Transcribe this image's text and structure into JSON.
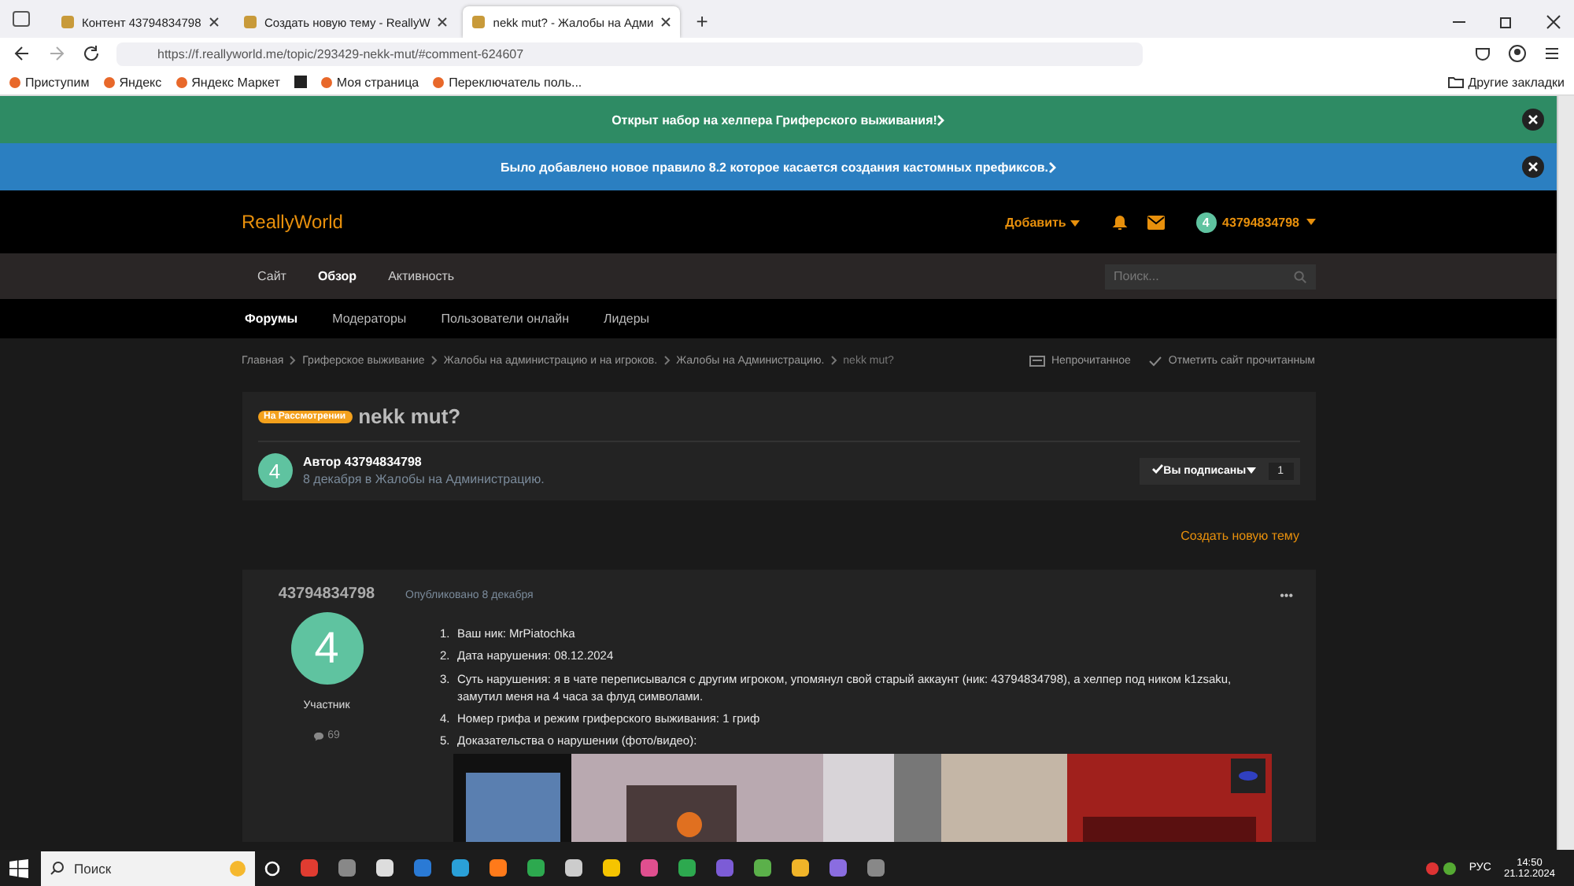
{
  "browser": {
    "tabs": [
      {
        "label": "Контент 43794834798",
        "selected": false
      },
      {
        "label": "Создать новую тему - ReallyW",
        "selected": false
      },
      {
        "label": "nekk mut? - Жалобы на Адми",
        "selected": true
      }
    ],
    "new_tab": "+",
    "url": "https://f.reallyworld.me/topic/293429-nekk-mut/#comment-624607",
    "bookmarks": [
      {
        "kind": "link",
        "label": "Приступим"
      },
      {
        "kind": "link",
        "label": "Яндекс"
      },
      {
        "kind": "link",
        "label": "Яндекс Маркет"
      },
      {
        "kind": "icon"
      },
      {
        "kind": "link",
        "label": "Моя страница"
      },
      {
        "kind": "link",
        "label": "Переключатель поль..."
      }
    ],
    "other_bookmarks": "Другие закладки"
  },
  "banners": [
    {
      "text": "Открыт набор на хелпера Гриферского выживания!",
      "color": "#2e8b64"
    },
    {
      "text": "Было добавлено новое правило 8.2 которое касается создания кастомных префиксов.",
      "color": "#2b7fc1"
    }
  ],
  "header": {
    "logo": "ReallyWorld",
    "add": "Добавить",
    "avatar": "4",
    "user": "43794834798"
  },
  "nav": [
    {
      "label": "Сайт",
      "selected": false
    },
    {
      "label": "Обзор",
      "selected": true
    },
    {
      "label": "Активность",
      "selected": false
    }
  ],
  "search": {
    "placeholder": "Поиск..."
  },
  "subnav": [
    {
      "label": "Форумы",
      "selected": true
    },
    {
      "label": "Модераторы",
      "selected": false
    },
    {
      "label": "Пользователи онлайн",
      "selected": false
    },
    {
      "label": "Лидеры",
      "selected": false
    }
  ],
  "breadcrumbs": [
    "Главная",
    "Гриферское выживание",
    "Жалобы на администрацию и на игроков.",
    "Жалобы на Администрацию.",
    "nekk mut?"
  ],
  "breadcrumb_actions": [
    "Непрочитанное",
    "Отметить сайт прочитанным"
  ],
  "topic": {
    "badge": "На Рассмотрении",
    "title": "nekk mut?",
    "avatar": "4",
    "author": "Автор 43794834798",
    "meta": "8 декабря в Жалобы на Администрацию.",
    "follow": "Вы подписаны",
    "follow_count": "1"
  },
  "create_topic": "Создать новую тему",
  "post": {
    "author": "43794834798",
    "avatar": "4",
    "role": "Участник",
    "posts": "69",
    "published": "Опубликовано 8 декабря",
    "menu": "•••",
    "items": [
      {
        "num": "1.",
        "text": "Ваш ник: MrPiatochka"
      },
      {
        "num": "2.",
        "text": "Дата нарушения: 08.12.2024"
      },
      {
        "num": "3.",
        "text": "Суть нарушения: я в чате переписывался с другим  игроком, упомянул свой старый аккаунт (ник: 43794834798), а хелпер под ником k1zsaku, замутил меня на 4 часа за флуд символами."
      },
      {
        "num": "4.",
        "text": "Номер грифа и режим гриферского выживания: 1 гриф"
      },
      {
        "num": "5.",
        "text": "Доказательства о нарушении (фото/видео):"
      }
    ]
  },
  "taskbar": {
    "search": "Поиск",
    "lang": "РУС",
    "time": "14:50",
    "date": "21.12.2024"
  }
}
